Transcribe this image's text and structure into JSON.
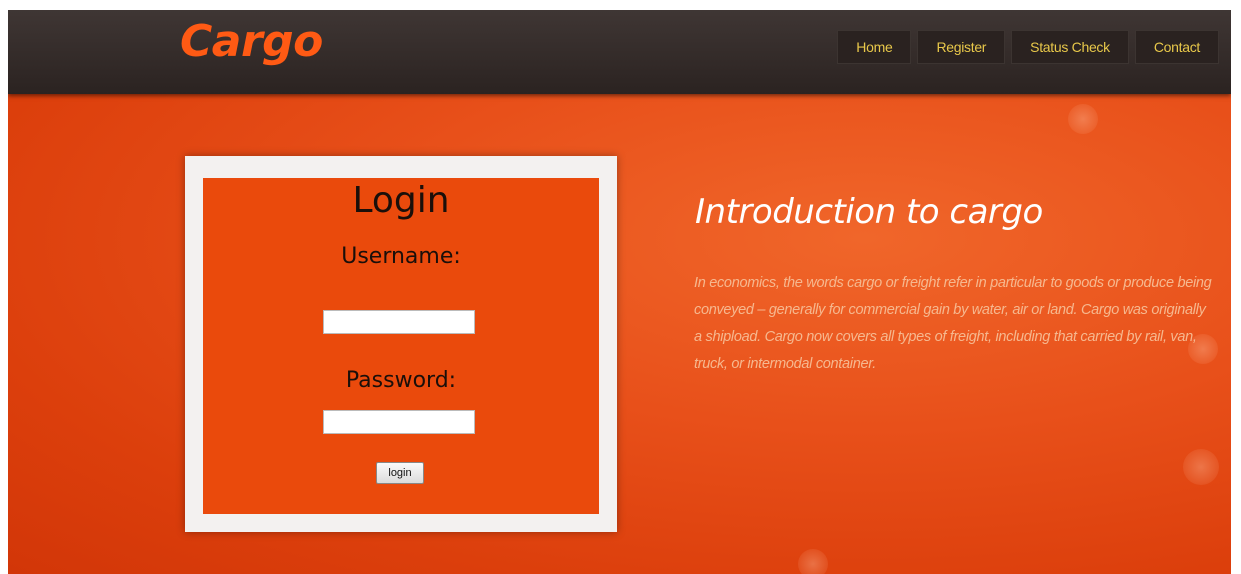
{
  "brand": {
    "logo_text": "Cargo",
    "accent_color": "#ff5a14"
  },
  "nav": {
    "items": [
      {
        "label": "Home"
      },
      {
        "label": "Register"
      },
      {
        "label": "Status Check"
      },
      {
        "label": "Contact"
      }
    ]
  },
  "login": {
    "title": "Login",
    "username_label": "Username:",
    "username_value": "",
    "password_label": "Password:",
    "password_value": "",
    "submit_label": "login"
  },
  "intro": {
    "title": "Introduction to cargo",
    "body": "In economics, the words cargo or freight refer in particular to goods or produce being conveyed – generally for commercial gain by water, air or land. Cargo was originally a shipload. Cargo now covers all types of freight, including that carried by rail, van, truck, or intermodal container."
  },
  "colors": {
    "header_bg": "#2b2321",
    "nav_text": "#e8c84a",
    "main_bg": "#e8501a",
    "login_panel": "#ea4a0c"
  }
}
